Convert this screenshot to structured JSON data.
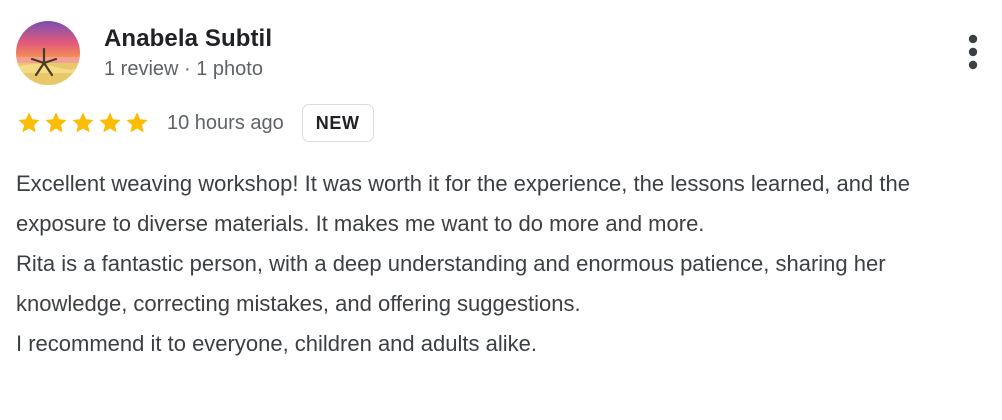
{
  "review": {
    "author": {
      "name": "Anabela Subtil",
      "meta": "1 review · 1 photo",
      "avatar_icon": "beach-sunset-starfish-avatar"
    },
    "menu_icon": "more-vert-icon",
    "rating": {
      "stars": 5,
      "max_stars": 5,
      "star_color": "#fbbc04",
      "time": "10 hours ago",
      "badge": "NEW"
    },
    "text_paragraphs": [
      "Excellent weaving workshop! It was worth it for the experience, the lessons learned, and the exposure to diverse materials. It makes me want to do more and more.",
      "Rita is a fantastic person, with a deep understanding and enormous patience, sharing her knowledge, correcting mistakes, and offering suggestions.",
      "I recommend it to everyone, children and adults alike."
    ]
  }
}
